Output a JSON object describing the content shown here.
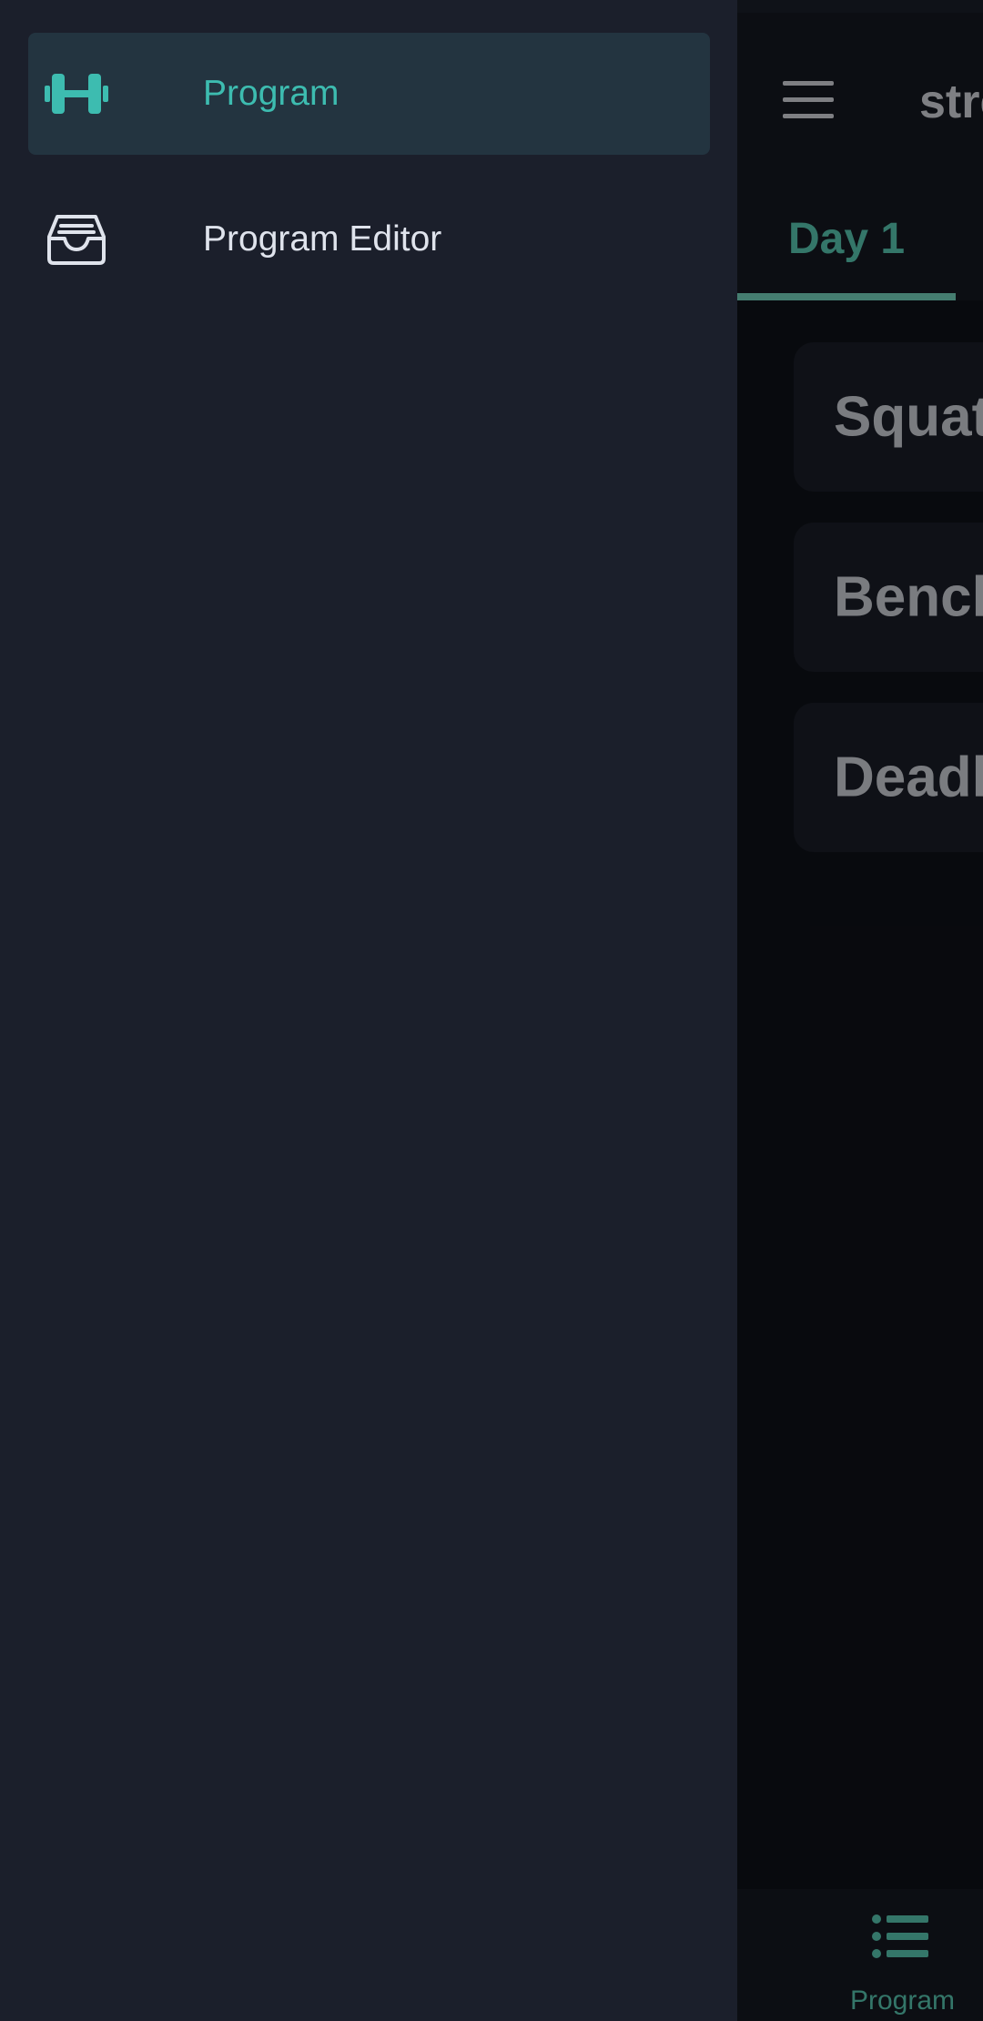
{
  "drawer": {
    "items": [
      {
        "label": "Program",
        "icon": "dumbbell-icon",
        "active": true
      },
      {
        "label": "Program Editor",
        "icon": "inbox-tray-icon",
        "active": false
      }
    ]
  },
  "app": {
    "title": "strength",
    "menu_icon": "hamburger-menu-icon",
    "tabs": [
      {
        "label": "Day 1",
        "selected": true
      }
    ],
    "exercises": [
      {
        "name": "Squat"
      },
      {
        "name": "Bench"
      },
      {
        "name": "Deadlift"
      }
    ],
    "bottom_nav": [
      {
        "label": "Program",
        "icon": "list-icon",
        "selected": true
      }
    ]
  },
  "colors": {
    "accent": "#3dbcb0",
    "drawer_bg": "#1b1f2b",
    "drawer_active_bg": "#233440",
    "tab_accent": "#5fd7bf"
  }
}
